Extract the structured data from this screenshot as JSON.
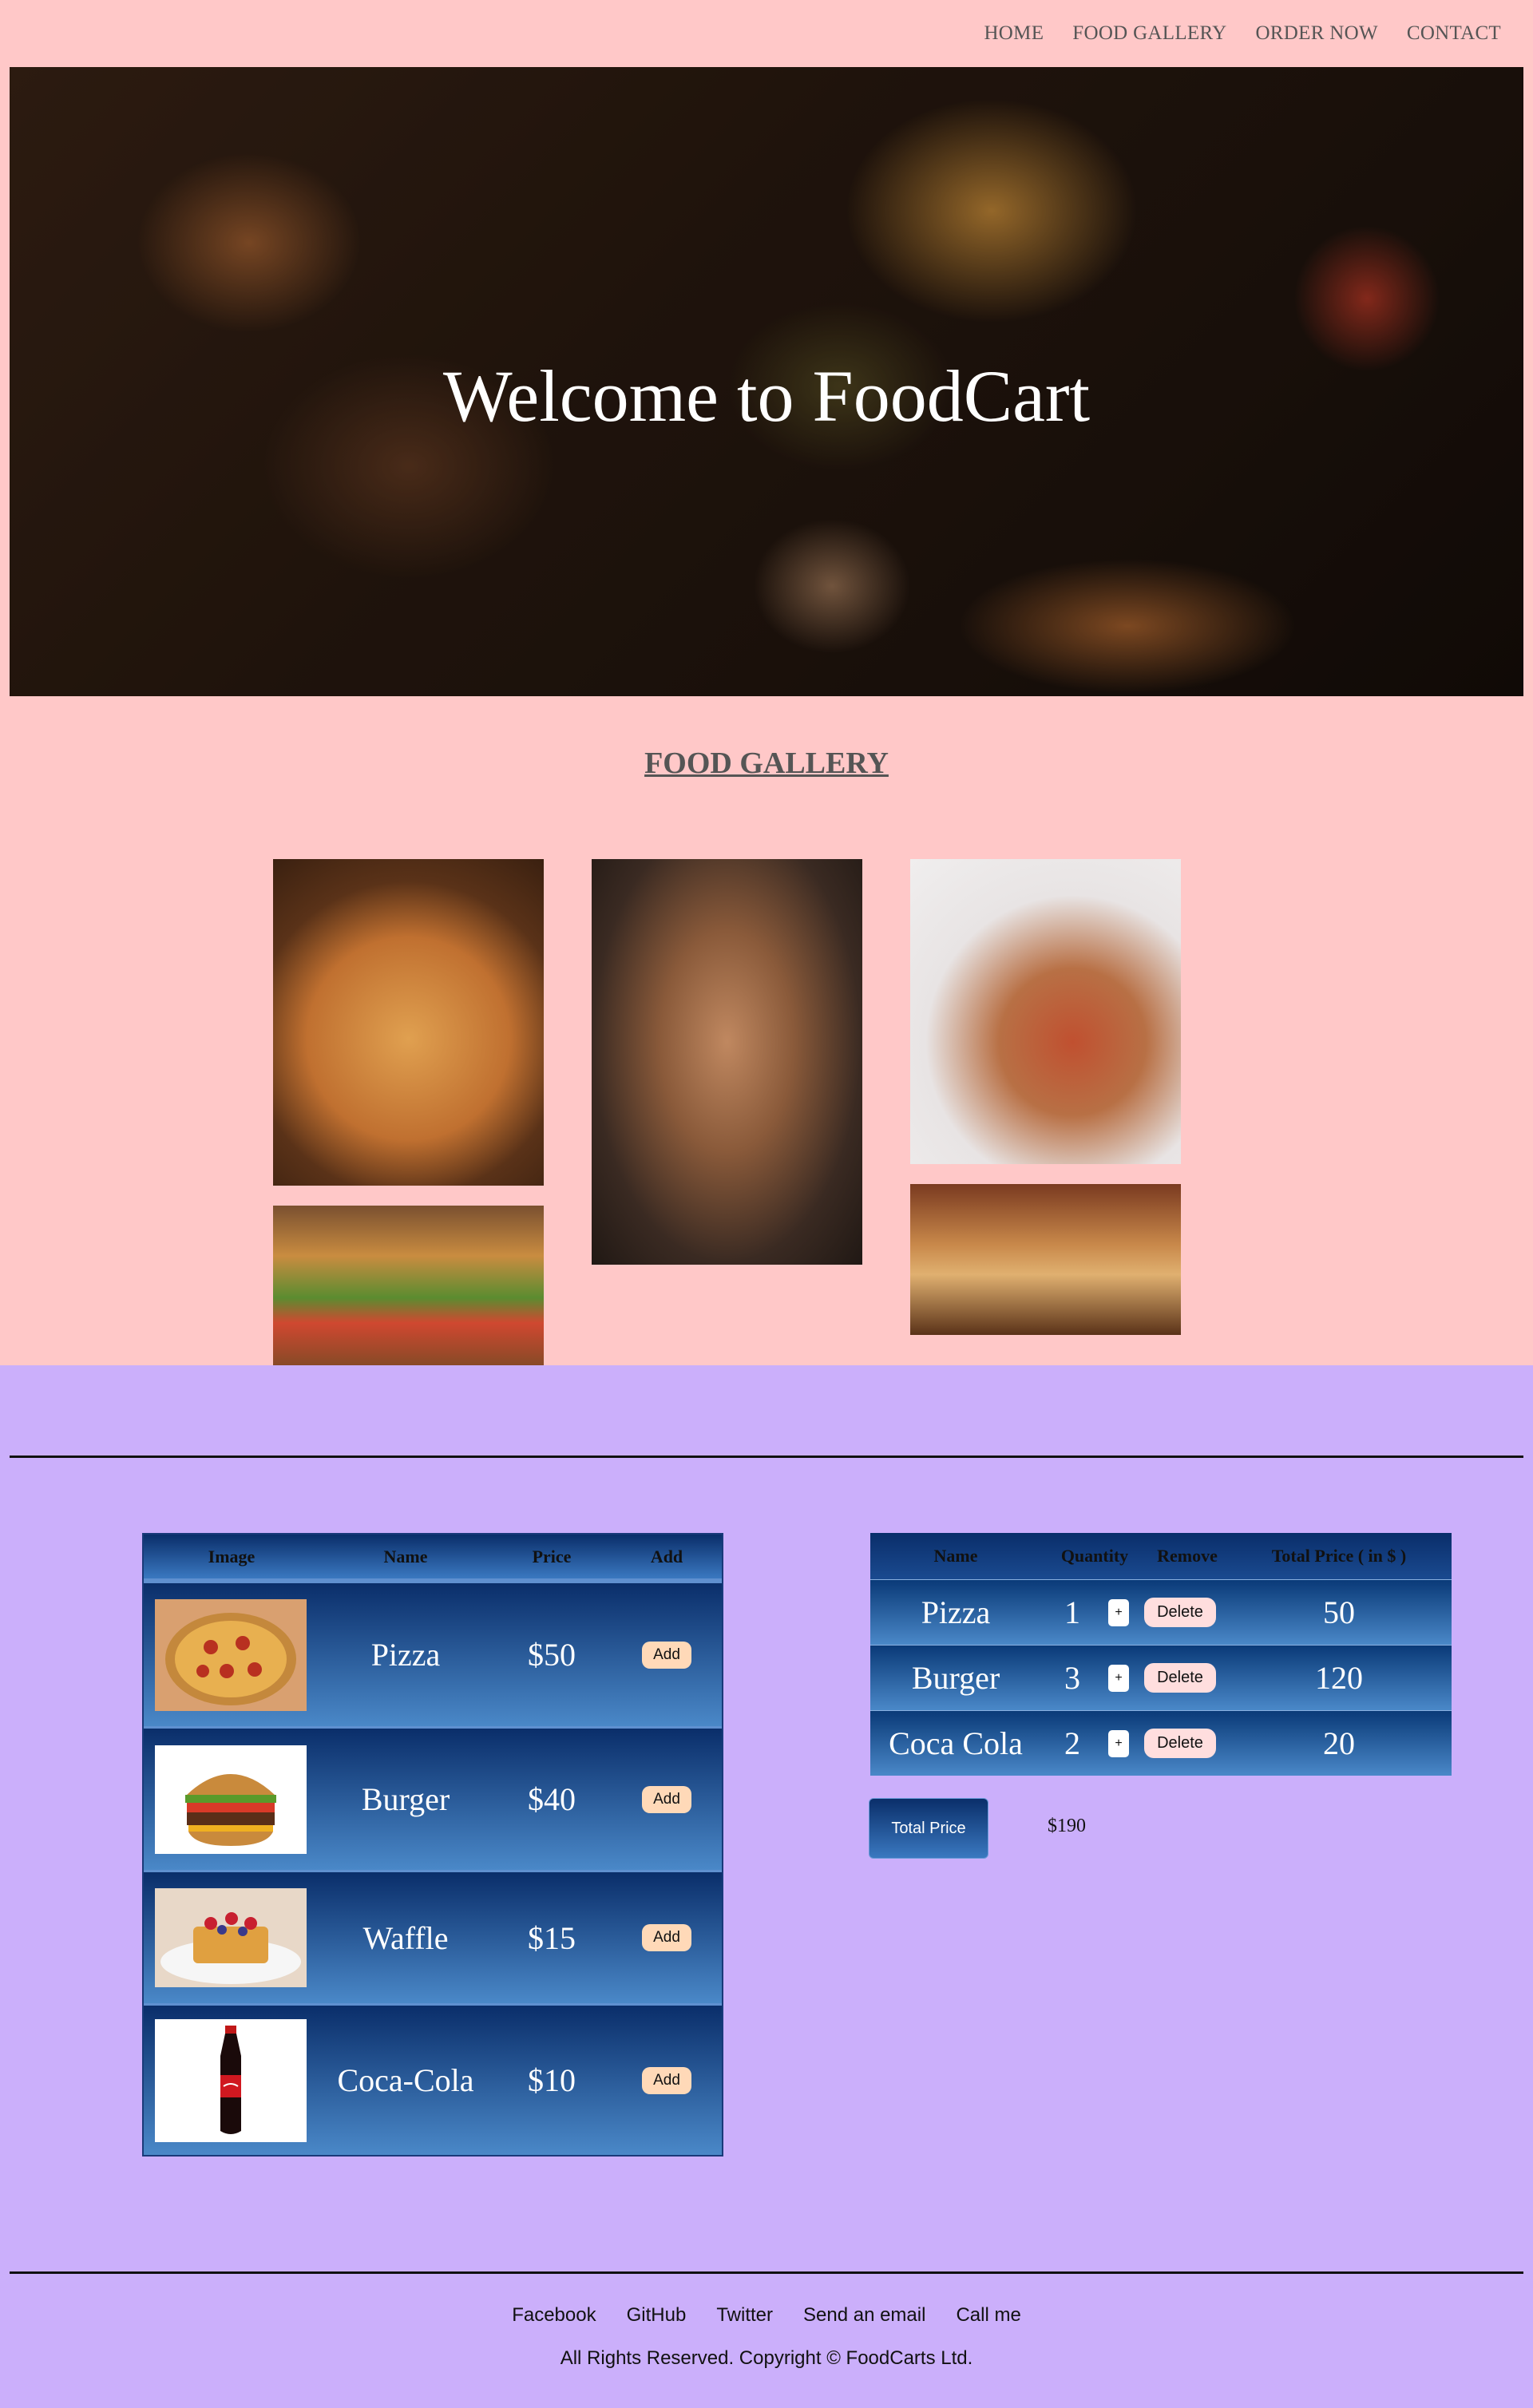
{
  "nav": {
    "items": [
      {
        "label": "HOME"
      },
      {
        "label": "FOOD GALLERY"
      },
      {
        "label": "ORDER NOW"
      },
      {
        "label": "CONTACT"
      }
    ]
  },
  "hero": {
    "title": "Welcome to FoodCart"
  },
  "gallery": {
    "title": "FOOD GALLERY"
  },
  "menu": {
    "headers": [
      "Image",
      "Name",
      "Price",
      "Add"
    ],
    "items": [
      {
        "name": "Pizza",
        "price": "$50",
        "add_label": "Add"
      },
      {
        "name": "Burger",
        "price": "$40",
        "add_label": "Add"
      },
      {
        "name": "Waffle",
        "price": "$15",
        "add_label": "Add"
      },
      {
        "name": "Coca-Cola",
        "price": "$10",
        "add_label": "Add"
      }
    ]
  },
  "cart": {
    "headers": [
      "Name",
      "Quantity",
      "Remove",
      "Total Price ( in $ )"
    ],
    "rows": [
      {
        "name": "Pizza",
        "quantity": "1",
        "plus_label": "+",
        "delete_label": "Delete",
        "total": "50"
      },
      {
        "name": "Burger",
        "quantity": "3",
        "plus_label": "+",
        "delete_label": "Delete",
        "total": "120"
      },
      {
        "name": "Coca Cola",
        "quantity": "2",
        "plus_label": "+",
        "delete_label": "Delete",
        "total": "20"
      }
    ],
    "total_label": "Total Price",
    "total_value": "$190"
  },
  "footer": {
    "links": [
      {
        "label": "Facebook"
      },
      {
        "label": "GitHub"
      },
      {
        "label": "Twitter"
      },
      {
        "label": "Send an email"
      },
      {
        "label": "Call me"
      }
    ],
    "copyright": "All Rights Reserved. Copyright © FoodCarts Ltd."
  },
  "colors": {
    "page_background": "#ffc8c8",
    "section_background": "#cbaffb",
    "table_gradient_top": "#0a2e6a",
    "table_gradient_bottom": "#4a88c8",
    "add_button": "#ffd9b8",
    "delete_button": "#ffdede"
  }
}
